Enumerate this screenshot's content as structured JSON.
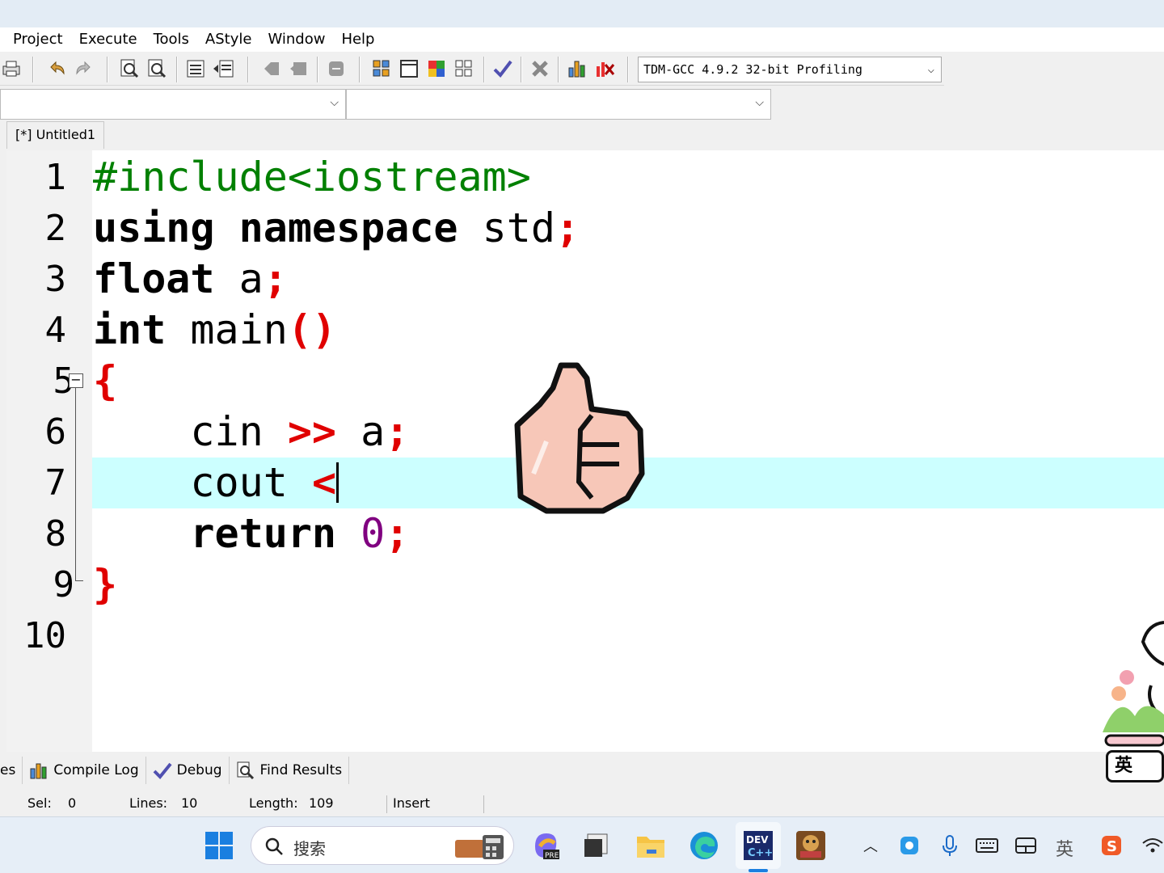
{
  "menu": [
    "Project",
    "Execute",
    "Tools",
    "AStyle",
    "Window",
    "Help"
  ],
  "compiler": "TDM-GCC 4.9.2 32-bit Profiling",
  "file_tab": "[*] Untitled1",
  "lines": [
    {
      "num": "1",
      "text": "#include<iostream>"
    },
    {
      "num": "2",
      "text": "using namespace std;"
    },
    {
      "num": "3",
      "text": "float a;"
    },
    {
      "num": "4",
      "text": "int main()"
    },
    {
      "num": "5",
      "text": "{"
    },
    {
      "num": "6",
      "text": "    cin >> a;"
    },
    {
      "num": "7",
      "text": "    cout <"
    },
    {
      "num": "8",
      "text": "    return 0;"
    },
    {
      "num": "9",
      "text": "}"
    },
    {
      "num": "10",
      "text": ""
    }
  ],
  "bottom_tabs": {
    "partial": "es",
    "compile_log": "Compile Log",
    "debug": "Debug",
    "find_results": "Find Results"
  },
  "status": {
    "sel_label": "Sel:",
    "sel_value": "0",
    "lines_label": "Lines:",
    "lines_value": "10",
    "length_label": "Length:",
    "length_value": "109",
    "mode": "Insert"
  },
  "taskbar": {
    "search_placeholder": "搜索",
    "ime_label": "英"
  },
  "colors": {
    "keyword": "#000000",
    "symbol": "#e00000",
    "preprocessor": "#008000",
    "number": "#800080",
    "current_line": "#ccffff"
  },
  "icons": [
    "print-icon",
    "undo-icon",
    "redo-icon",
    "find-icon",
    "replace-icon",
    "indent-icon",
    "unindent-icon",
    "bookmark-icon",
    "project-icon",
    "window-icon",
    "color-icon",
    "tile-icon",
    "check-icon",
    "close-icon",
    "chart-icon",
    "debug-icon",
    "windows-start-icon",
    "search-icon",
    "calculator-icon",
    "copilot-icon",
    "app-icon",
    "folder-icon",
    "edge-icon",
    "devcpp-icon",
    "game-icon",
    "chevron-up-icon",
    "feedback-icon",
    "mic-icon",
    "keyboard-icon",
    "layout-icon",
    "ime-icon",
    "sogou-icon",
    "wifi-icon",
    "thumbs-up-sticker",
    "rabbit-sticker"
  ]
}
